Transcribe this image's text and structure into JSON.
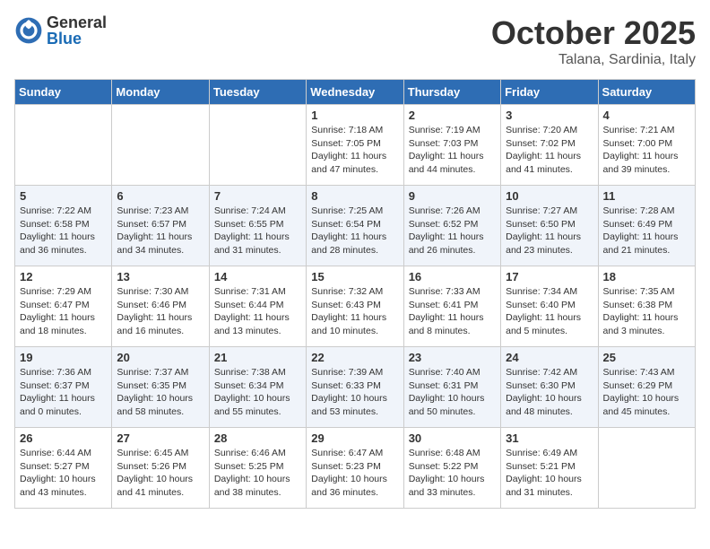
{
  "header": {
    "logo_general": "General",
    "logo_blue": "Blue",
    "month": "October 2025",
    "location": "Talana, Sardinia, Italy"
  },
  "days_of_week": [
    "Sunday",
    "Monday",
    "Tuesday",
    "Wednesday",
    "Thursday",
    "Friday",
    "Saturday"
  ],
  "weeks": [
    [
      {
        "day": "",
        "info": ""
      },
      {
        "day": "",
        "info": ""
      },
      {
        "day": "",
        "info": ""
      },
      {
        "day": "1",
        "info": "Sunrise: 7:18 AM\nSunset: 7:05 PM\nDaylight: 11 hours and 47 minutes."
      },
      {
        "day": "2",
        "info": "Sunrise: 7:19 AM\nSunset: 7:03 PM\nDaylight: 11 hours and 44 minutes."
      },
      {
        "day": "3",
        "info": "Sunrise: 7:20 AM\nSunset: 7:02 PM\nDaylight: 11 hours and 41 minutes."
      },
      {
        "day": "4",
        "info": "Sunrise: 7:21 AM\nSunset: 7:00 PM\nDaylight: 11 hours and 39 minutes."
      }
    ],
    [
      {
        "day": "5",
        "info": "Sunrise: 7:22 AM\nSunset: 6:58 PM\nDaylight: 11 hours and 36 minutes."
      },
      {
        "day": "6",
        "info": "Sunrise: 7:23 AM\nSunset: 6:57 PM\nDaylight: 11 hours and 34 minutes."
      },
      {
        "day": "7",
        "info": "Sunrise: 7:24 AM\nSunset: 6:55 PM\nDaylight: 11 hours and 31 minutes."
      },
      {
        "day": "8",
        "info": "Sunrise: 7:25 AM\nSunset: 6:54 PM\nDaylight: 11 hours and 28 minutes."
      },
      {
        "day": "9",
        "info": "Sunrise: 7:26 AM\nSunset: 6:52 PM\nDaylight: 11 hours and 26 minutes."
      },
      {
        "day": "10",
        "info": "Sunrise: 7:27 AM\nSunset: 6:50 PM\nDaylight: 11 hours and 23 minutes."
      },
      {
        "day": "11",
        "info": "Sunrise: 7:28 AM\nSunset: 6:49 PM\nDaylight: 11 hours and 21 minutes."
      }
    ],
    [
      {
        "day": "12",
        "info": "Sunrise: 7:29 AM\nSunset: 6:47 PM\nDaylight: 11 hours and 18 minutes."
      },
      {
        "day": "13",
        "info": "Sunrise: 7:30 AM\nSunset: 6:46 PM\nDaylight: 11 hours and 16 minutes."
      },
      {
        "day": "14",
        "info": "Sunrise: 7:31 AM\nSunset: 6:44 PM\nDaylight: 11 hours and 13 minutes."
      },
      {
        "day": "15",
        "info": "Sunrise: 7:32 AM\nSunset: 6:43 PM\nDaylight: 11 hours and 10 minutes."
      },
      {
        "day": "16",
        "info": "Sunrise: 7:33 AM\nSunset: 6:41 PM\nDaylight: 11 hours and 8 minutes."
      },
      {
        "day": "17",
        "info": "Sunrise: 7:34 AM\nSunset: 6:40 PM\nDaylight: 11 hours and 5 minutes."
      },
      {
        "day": "18",
        "info": "Sunrise: 7:35 AM\nSunset: 6:38 PM\nDaylight: 11 hours and 3 minutes."
      }
    ],
    [
      {
        "day": "19",
        "info": "Sunrise: 7:36 AM\nSunset: 6:37 PM\nDaylight: 11 hours and 0 minutes."
      },
      {
        "day": "20",
        "info": "Sunrise: 7:37 AM\nSunset: 6:35 PM\nDaylight: 10 hours and 58 minutes."
      },
      {
        "day": "21",
        "info": "Sunrise: 7:38 AM\nSunset: 6:34 PM\nDaylight: 10 hours and 55 minutes."
      },
      {
        "day": "22",
        "info": "Sunrise: 7:39 AM\nSunset: 6:33 PM\nDaylight: 10 hours and 53 minutes."
      },
      {
        "day": "23",
        "info": "Sunrise: 7:40 AM\nSunset: 6:31 PM\nDaylight: 10 hours and 50 minutes."
      },
      {
        "day": "24",
        "info": "Sunrise: 7:42 AM\nSunset: 6:30 PM\nDaylight: 10 hours and 48 minutes."
      },
      {
        "day": "25",
        "info": "Sunrise: 7:43 AM\nSunset: 6:29 PM\nDaylight: 10 hours and 45 minutes."
      }
    ],
    [
      {
        "day": "26",
        "info": "Sunrise: 6:44 AM\nSunset: 5:27 PM\nDaylight: 10 hours and 43 minutes."
      },
      {
        "day": "27",
        "info": "Sunrise: 6:45 AM\nSunset: 5:26 PM\nDaylight: 10 hours and 41 minutes."
      },
      {
        "day": "28",
        "info": "Sunrise: 6:46 AM\nSunset: 5:25 PM\nDaylight: 10 hours and 38 minutes."
      },
      {
        "day": "29",
        "info": "Sunrise: 6:47 AM\nSunset: 5:23 PM\nDaylight: 10 hours and 36 minutes."
      },
      {
        "day": "30",
        "info": "Sunrise: 6:48 AM\nSunset: 5:22 PM\nDaylight: 10 hours and 33 minutes."
      },
      {
        "day": "31",
        "info": "Sunrise: 6:49 AM\nSunset: 5:21 PM\nDaylight: 10 hours and 31 minutes."
      },
      {
        "day": "",
        "info": ""
      }
    ]
  ]
}
